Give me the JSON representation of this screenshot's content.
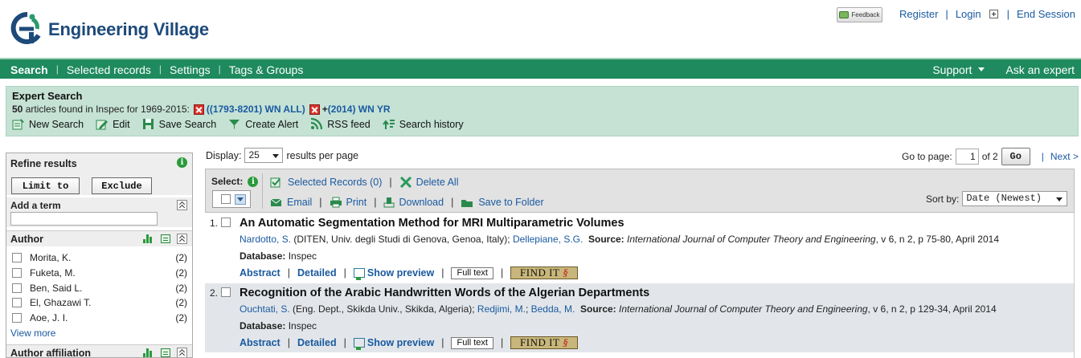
{
  "header": {
    "logo_text": "Engineering Village",
    "feedback_label": "Feedback",
    "links": {
      "register": "Register",
      "login": "Login",
      "end_session": "End Session"
    }
  },
  "nav": {
    "items": [
      "Search",
      "Selected records",
      "Settings",
      "Tags & Groups"
    ],
    "support": "Support",
    "ask": "Ask an expert"
  },
  "expert": {
    "title": "Expert Search",
    "count": "50",
    "found_text": "articles found in Inspec for 1969-2015:",
    "term1": "((1793-8201) WN ALL)",
    "plus": "+",
    "term2": "(2014) WN YR",
    "actions": [
      "New Search",
      "Edit",
      "Save Search",
      "Create Alert",
      "RSS feed",
      "Search history"
    ]
  },
  "refine": {
    "title": "Refine results",
    "limit_to": "Limit to",
    "exclude": "Exclude",
    "add_term": "Add a term",
    "author_title": "Author",
    "authors": [
      {
        "name": "Morita, K.",
        "count": "(2)"
      },
      {
        "name": "Fuketa, M.",
        "count": "(2)"
      },
      {
        "name": "Ben, Said L.",
        "count": "(2)"
      },
      {
        "name": "El, Ghazawi T.",
        "count": "(2)"
      },
      {
        "name": "Aoe, J. I.",
        "count": "(2)"
      }
    ],
    "view_more": "View more",
    "affiliation_title": "Author affiliation"
  },
  "results": {
    "display_label": "Display:",
    "display_value": "25",
    "per_page": "results per page",
    "goto_label": "Go to page:",
    "page_value": "1",
    "of_pages": "of 2",
    "go": "Go",
    "next": "Next >",
    "select_label": "Select:",
    "selected_records": "Selected Records (0)",
    "delete_all": "Delete All",
    "email": "Email",
    "print": "Print",
    "download": "Download",
    "save_folder": "Save to Folder",
    "sort_label": "Sort by:",
    "sort_value": "Date (Newest)"
  },
  "records": [
    {
      "num": "1.",
      "title": "An Automatic Segmentation Method for MRI Multiparametric Volumes",
      "author1": "Nardotto, S.",
      "affil1": " (DITEN, Univ. degli Studi di Genova, Genoa, Italy); ",
      "author2": "Dellepiane, S.G.",
      "author3": "",
      "source_label": "Source:",
      "journal": "International Journal of Computer Theory and Engineering",
      "details": ", v 6, n 2, p 75-80, April 2014",
      "db_label": "Database:",
      "db": " Inspec"
    },
    {
      "num": "2.",
      "title": "Recognition of the Arabic Handwritten Words of the Algerian Departments",
      "author1": "Ouchtati, S.",
      "affil1": " (Eng. Dept., Skikda Univ., Skikda, Algeria); ",
      "author2": "Redjimi, M.",
      "author3": "Bedda, M.",
      "source_label": "Source:",
      "journal": "International Journal of Computer Theory and Engineering",
      "details": ", v 6, n 2, p 129-34, April 2014",
      "db_label": "Database:",
      "db": " Inspec"
    }
  ],
  "record_links": {
    "abstract": "Abstract",
    "detailed": "Detailed",
    "preview": "Show preview",
    "full_text": "Full text",
    "find_it": "FIND IT"
  }
}
